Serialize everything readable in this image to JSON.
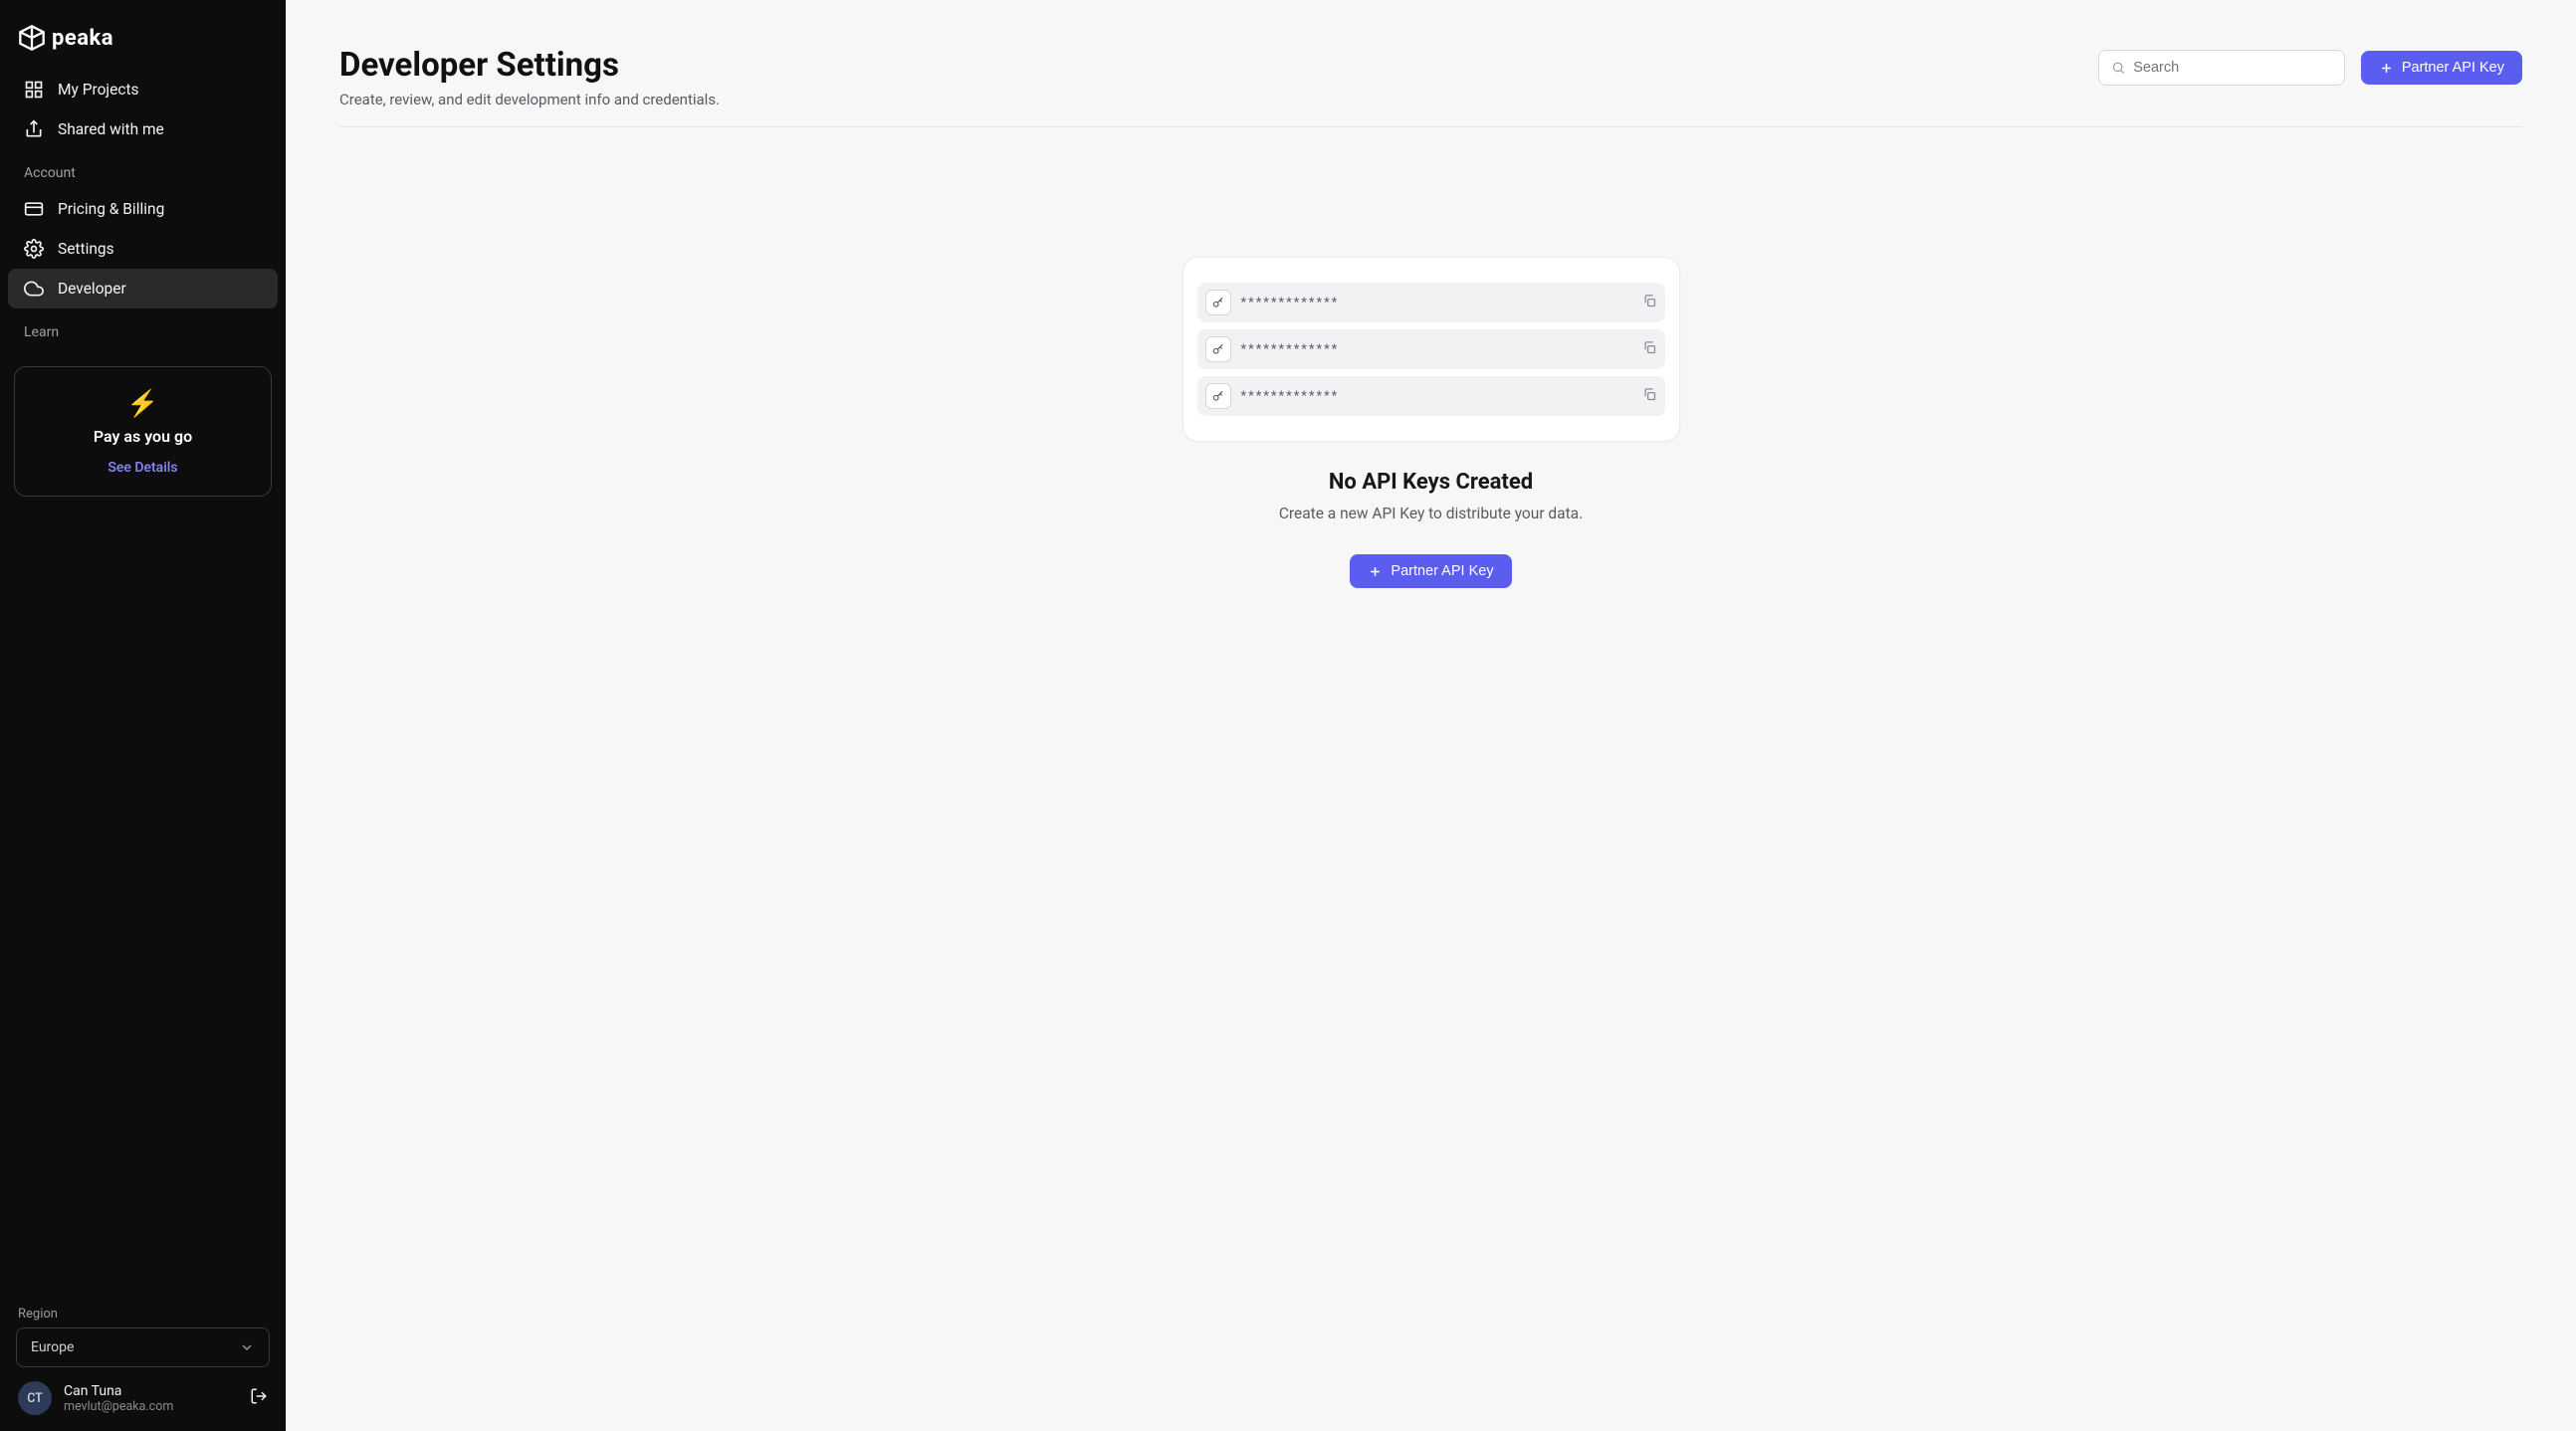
{
  "brand": "peaka",
  "sidebar": {
    "top": [
      {
        "label": "My Projects",
        "icon": "grid-icon"
      },
      {
        "label": "Shared with me",
        "icon": "share-icon"
      }
    ],
    "account_section": "Account",
    "account": [
      {
        "label": "Pricing & Billing",
        "icon": "card-icon"
      },
      {
        "label": "Settings",
        "icon": "gear-icon"
      },
      {
        "label": "Developer",
        "icon": "cloud-icon",
        "active": true
      }
    ],
    "learn_section": "Learn",
    "promo": {
      "emoji": "⚡",
      "title": "Pay as you go",
      "cta": "See Details"
    },
    "region_label": "Region",
    "region_value": "Europe",
    "user": {
      "initials": "CT",
      "name": "Can Tuna",
      "email": "mevlut@peaka.com"
    }
  },
  "header": {
    "title": "Developer Settings",
    "subtitle": "Create, review, and edit development info and credentials.",
    "search_placeholder": "Search",
    "button": "Partner API Key"
  },
  "empty": {
    "mask": "*************",
    "title": "No API Keys Created",
    "subtitle": "Create a new API Key to distribute your data.",
    "button": "Partner API Key"
  }
}
